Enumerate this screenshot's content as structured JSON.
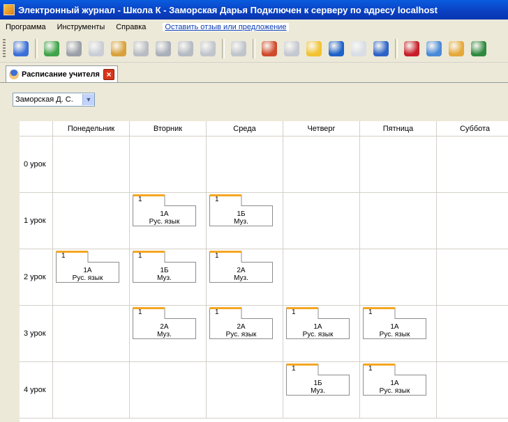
{
  "window": {
    "title": "Электронный журнал - Школа К - Заморская Дарья Подключен к серверу по адресу localhost"
  },
  "menu": {
    "items": [
      "Программа",
      "Инструменты",
      "Справка"
    ],
    "feedback_link": "Оставить отзыв или предложение"
  },
  "toolbar": {
    "buttons": [
      {
        "icon": "teacher-icon",
        "color": "#3a6fd8"
      },
      {
        "icon": "users-green-icon",
        "color": "#3fa44a"
      },
      {
        "icon": "clock-icon",
        "color": "#9b9fa8"
      },
      {
        "icon": "document-icon",
        "color": "#c9cdd6"
      },
      {
        "icon": "group-icon",
        "color": "#d9a13c"
      },
      {
        "icon": "person-gray-icon",
        "color": "#b9bcc4"
      },
      {
        "icon": "books-gray-icon",
        "color": "#aab0ba"
      },
      {
        "icon": "five-grade-icon",
        "color": "#b5bac3"
      },
      {
        "icon": "chart-gray-icon",
        "color": "#c0c5cd"
      },
      {
        "icon": "table-gray-icon",
        "color": "#bfc4cc"
      },
      {
        "icon": "bar-chart-icon",
        "color": "#d04a2c"
      },
      {
        "icon": "envelopes-gray-icon",
        "color": "#c4c8d0"
      },
      {
        "icon": "envelope-yellow-icon",
        "color": "#f2c230"
      },
      {
        "icon": "mailbox-icon",
        "color": "#1f62c8"
      },
      {
        "icon": "envelope-icon",
        "color": "#d8dde6"
      },
      {
        "icon": "journal-blue-icon",
        "color": "#2d63c8"
      },
      {
        "icon": "journal-red-icon",
        "color": "#c81e2a"
      },
      {
        "icon": "globe-settings-icon",
        "color": "#4a89d8"
      },
      {
        "icon": "people-color-icon",
        "color": "#e5a83a"
      },
      {
        "icon": "globe-icon",
        "color": "#2f8a3f"
      }
    ]
  },
  "tab": {
    "label": "Расписание учителя"
  },
  "teacher_select": {
    "value": "Заморская Д. С."
  },
  "schedule": {
    "days": [
      "Понедельник",
      "Вторник",
      "Среда",
      "Четверг",
      "Пятница",
      "Суббота"
    ],
    "lessons": [
      "0 урок",
      "1 урок",
      "2 урок",
      "3 урок",
      "4 урок"
    ],
    "entries": [
      {
        "row": 1,
        "day": 1,
        "num": "1",
        "cls": "1А",
        "subj": "Рус. язык"
      },
      {
        "row": 1,
        "day": 2,
        "num": "1",
        "cls": "1Б",
        "subj": "Муз."
      },
      {
        "row": 2,
        "day": 0,
        "num": "1",
        "cls": "1А",
        "subj": "Рус. язык"
      },
      {
        "row": 2,
        "day": 1,
        "num": "1",
        "cls": "1Б",
        "subj": "Муз."
      },
      {
        "row": 2,
        "day": 2,
        "num": "1",
        "cls": "2А",
        "subj": "Муз."
      },
      {
        "row": 3,
        "day": 1,
        "num": "1",
        "cls": "2А",
        "subj": "Муз."
      },
      {
        "row": 3,
        "day": 2,
        "num": "1",
        "cls": "2А",
        "subj": "Рус. язык"
      },
      {
        "row": 3,
        "day": 3,
        "num": "1",
        "cls": "1А",
        "subj": "Рус. язык"
      },
      {
        "row": 3,
        "day": 4,
        "num": "1",
        "cls": "1А",
        "subj": "Рус. язык"
      },
      {
        "row": 4,
        "day": 3,
        "num": "1",
        "cls": "1Б",
        "subj": "Муз."
      },
      {
        "row": 4,
        "day": 4,
        "num": "1",
        "cls": "1А",
        "subj": "Рус. язык"
      }
    ]
  }
}
